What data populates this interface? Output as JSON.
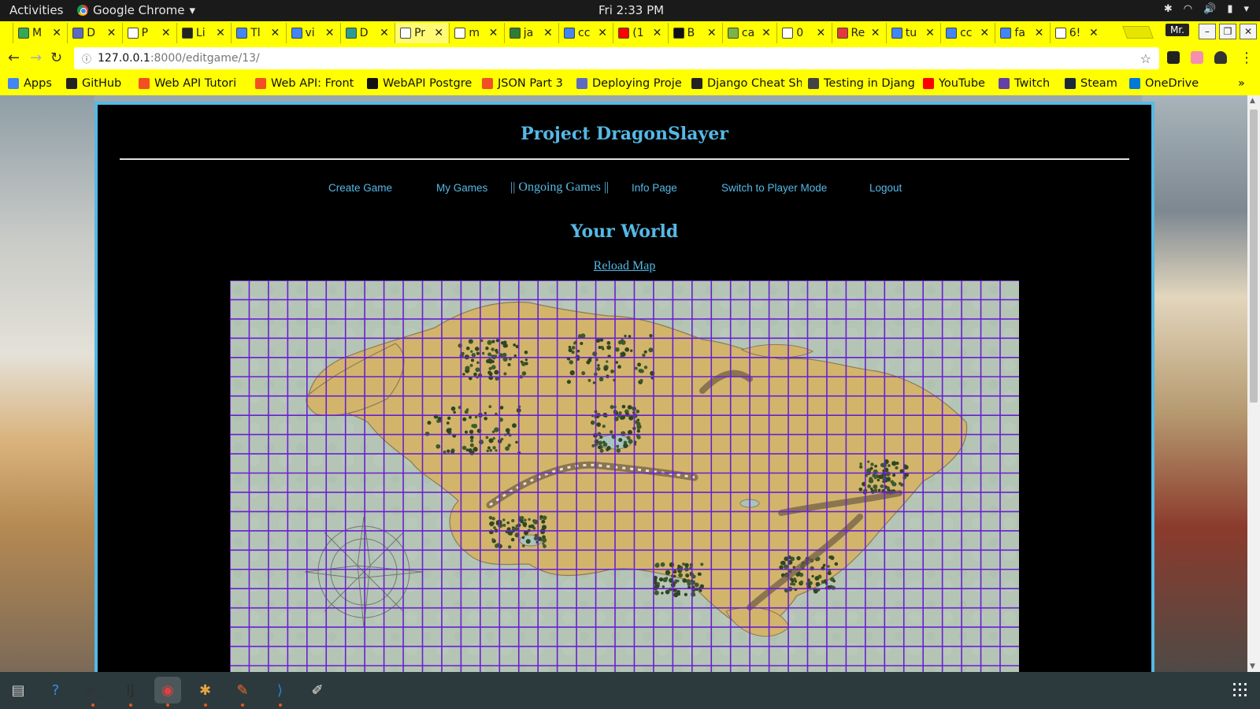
{
  "topbar": {
    "activities": "Activities",
    "app_name": "Google Chrome",
    "clock": "Fri  2:33 PM"
  },
  "tabs": [
    {
      "title": "M",
      "icon_color": "#34a853"
    },
    {
      "title": "D",
      "icon_color": "#5c6bc0"
    },
    {
      "title": "P",
      "icon_color": "#ffffff"
    },
    {
      "title": "Li",
      "icon_color": "#222222"
    },
    {
      "title": "Tl",
      "icon_color": "#4285f4"
    },
    {
      "title": "vi",
      "icon_color": "#4285f4"
    },
    {
      "title": "D",
      "icon_color": "#2a9d8f"
    },
    {
      "title": "Pr",
      "icon_color": "#ffffff",
      "active": true
    },
    {
      "title": "m",
      "icon_color": "#ffffff"
    },
    {
      "title": "ja",
      "icon_color": "#2e7d32"
    },
    {
      "title": "cc",
      "icon_color": "#4285f4"
    },
    {
      "title": "(1",
      "icon_color": "#ff0000"
    },
    {
      "title": "B",
      "icon_color": "#111111"
    },
    {
      "title": "ca",
      "icon_color": "#7cb342"
    },
    {
      "title": "0",
      "icon_color": "#ffffff"
    },
    {
      "title": "Re",
      "icon_color": "#e53935"
    },
    {
      "title": "tu",
      "icon_color": "#4285f4"
    },
    {
      "title": "cc",
      "icon_color": "#4285f4"
    },
    {
      "title": "fa",
      "icon_color": "#4285f4"
    },
    {
      "title": "6!",
      "icon_color": "#ffffff"
    }
  ],
  "profile": "Mr.",
  "address": {
    "host": "127.0.0.1",
    "path": ":8000/editgame/13/"
  },
  "bookmarks": [
    {
      "label": "Apps",
      "icon_color": "#4285f4"
    },
    {
      "label": "GitHub",
      "icon_color": "#222222"
    },
    {
      "label": "Web API Tutori",
      "icon_color": "#f25022"
    },
    {
      "label": "Web API: Front",
      "icon_color": "#f25022"
    },
    {
      "label": "WebAPI Postgre",
      "icon_color": "#111111"
    },
    {
      "label": "JSON Part 3",
      "icon_color": "#f25022"
    },
    {
      "label": "Deploying Proje",
      "icon_color": "#5c6bc0"
    },
    {
      "label": "Django Cheat Sh",
      "icon_color": "#222222"
    },
    {
      "label": "Testing in Djang",
      "icon_color": "#444444"
    },
    {
      "label": "YouTube",
      "icon_color": "#ff0000"
    },
    {
      "label": "Twitch",
      "icon_color": "#6441a5"
    },
    {
      "label": "Steam",
      "icon_color": "#1b2838"
    },
    {
      "label": "OneDrive",
      "icon_color": "#0078d4"
    }
  ],
  "page": {
    "title": "Project DragonSlayer",
    "nav": {
      "create_game": "Create Game",
      "my_games": "My Games",
      "ongoing_games": "|| Ongoing Games ||",
      "info_page": "Info Page",
      "switch_mode": "Switch to Player Mode",
      "logout": "Logout"
    },
    "world_heading": "Your World",
    "reload_link": "Reload Map"
  },
  "map": {
    "grid_color": "#6a1fd1",
    "water_color": "#a9c3bd",
    "land_color": "#d2b56b"
  },
  "dock": [
    {
      "name": "files-icon"
    },
    {
      "name": "help-icon"
    },
    {
      "name": "terminal-icon"
    },
    {
      "name": "intellij-icon"
    },
    {
      "name": "chrome-icon",
      "active": true
    },
    {
      "name": "slack-icon"
    },
    {
      "name": "postman-icon"
    },
    {
      "name": "vscode-icon"
    },
    {
      "name": "text-editor-icon"
    }
  ]
}
